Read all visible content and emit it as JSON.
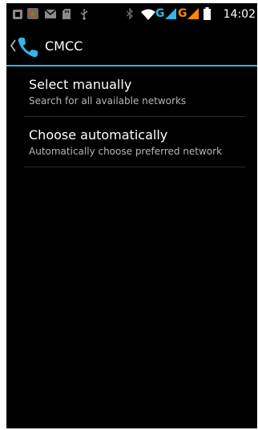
{
  "status_bar": {
    "time": "14:02",
    "network_1": "G",
    "network_2": "G",
    "icons": [
      "notification-icon",
      "gallery-icon",
      "email-icon",
      "sd-card-icon",
      "usb-icon",
      "bluetooth-icon",
      "wifi-icon",
      "signal-icon",
      "battery-icon"
    ]
  },
  "action_bar": {
    "title": "CMCC",
    "icon": "phone-icon"
  },
  "list": {
    "items": [
      {
        "title": "Select manually",
        "summary": "Search for all available networks"
      },
      {
        "title": "Choose automatically",
        "summary": "Automatically choose preferred network"
      }
    ]
  },
  "colors": {
    "background": "#000000",
    "accent": "#33b5e5",
    "network_blue": "#33b5e5",
    "network_orange": "#ff8800",
    "summary_text": "#b4b4b4"
  }
}
